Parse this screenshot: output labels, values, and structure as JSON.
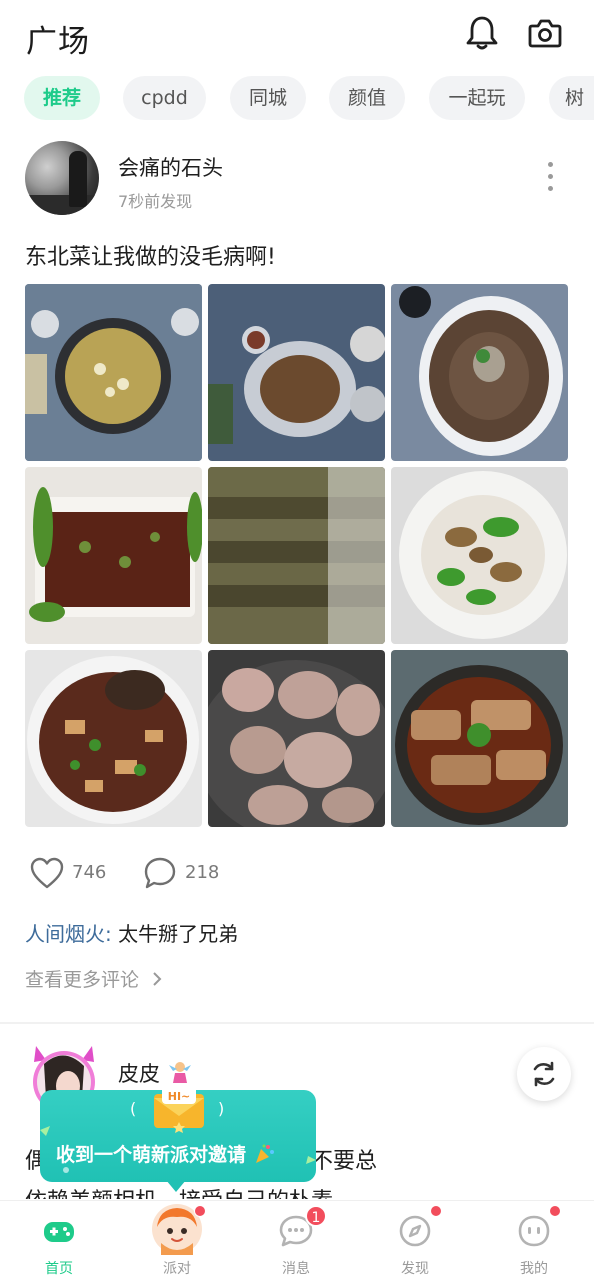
{
  "header": {
    "title": "广场"
  },
  "tabs": [
    "推荐",
    "cpdd",
    "同城",
    "颜值",
    "一起玩",
    "树"
  ],
  "post1": {
    "author": "会痛的石头",
    "time": "7秒前发现",
    "text": "东北菜让我做的没毛病啊!",
    "likes": "746",
    "comments": "218",
    "top_comment": {
      "user": "人间烟火",
      "sep": ":",
      "text": " 太牛掰了兄弟"
    },
    "view_more": "查看更多评论"
  },
  "post2": {
    "author": "皮皮",
    "text_line1": "偶尔也会对自己一点点信任，不要总",
    "text_line2": "依赖美颜相机，接受自己的朴素"
  },
  "toast": {
    "text": "收到一个萌新派对邀请",
    "badge_text": "HI~",
    "bracket_left": "(",
    "bracket_right": ")"
  },
  "nav": {
    "items": [
      {
        "label": "首页",
        "active": true
      },
      {
        "label": "派对"
      },
      {
        "label": "消息",
        "badge": "1"
      },
      {
        "label": "发现"
      },
      {
        "label": "我的"
      }
    ]
  },
  "colors": {
    "accent": "#1ecb8a",
    "badge": "#f24d5c",
    "toast": "#2ac8bb"
  }
}
